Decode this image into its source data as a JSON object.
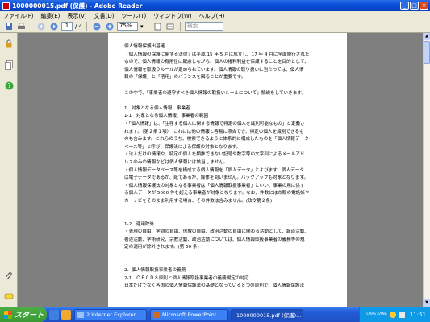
{
  "window": {
    "title": "1000000015.pdf (保護) - Adobe Reader"
  },
  "menu": {
    "items": [
      "ファイル(F)",
      "編集(E)",
      "表示(V)",
      "文書(D)",
      "ツール(T)",
      "ウィンドウ(W)",
      "ヘルプ(H)"
    ]
  },
  "toolbar": {
    "page_current": "1",
    "page_total": "/ 4",
    "zoom": "75%",
    "search_placeholder": "検索"
  },
  "document": {
    "lines": [
      "個人情報保護出基確",
      "",
      "「個人情報の保護に関する法律」は平成 15 年 5 月に成立し、17 年 4 月に全面施行された",
      "もので、個人情報の有用性に配慮しながら、個人の権利利益を保護することを目的として、",
      "個人情報を取扱うルールが定められています。個人情報の取り扱いに当たっては、個人情",
      "報の「保護」と「活用」のバランスを図ることが重要です。",
      "",
      "この中で、「事業者の遵守すべき個人情報の取扱いルールについて」解説をしていきます。",
      "",
      "1．対象となる個人情報、事業者",
      "1-1　対象となる個人情報、事業者の範囲",
      "・「個人情報」は、「生存する個人に関する情報で特定の個人を識別可能なもの」と定義さ",
      "れます。（第２条１項）　これには他の情報と容易に照合でき、特定の個人を識別できるも",
      "のも含みます。これらのうち、検索できるように体系的に構成したものを「個人情報データ",
      "ベース等」と呼び、保護法による保護の対象となります。",
      "・法人だけの情報や、特定の個人を類推できない記号や数字等の文字列によるメールアド",
      "レスのみの情報などは個人情報には該当しません。",
      "・個人情報データベース等を構成する個人情報を「個人データ」とよびます。個人データ",
      "は電子データであるか、紙であるか、媒体を問いません。バックアップも対象となります。",
      "・個人情報保護法の対象となる事業者は「個人情報取扱事業者」といい、事業の用に供す",
      "る個人データが 5000 件を超える事業者が対象となります。なお、件数には市販の電話帳や",
      "カーナビをそのまま利用する場合、その件数は含みません。(政令第２条)",
      "",
      "",
      "1-2　適用除外",
      "・表現の自由、学問の自由、信教の自由、政治活動の自由に関わる活動として、報道活動、",
      "著述活動、学術研究、宗教活動、政治活動については、個人情報取扱事業者の義務等の規",
      "定の適用が除外されます。(第 50 条)",
      "",
      "",
      "2．個人情報取扱事業者の義務",
      "2-1　ＯＥＣＤ８原則と個人情報取扱事業者の義務規定の対応",
      "日本だけでなく各国の個人情報保護法の基礎となっている８つの原則で、個人情報保護法"
    ]
  },
  "taskbar": {
    "start_label": "スタート",
    "tasks": [
      {
        "label": "2 Internet Explorer",
        "color": "#3f7fe0"
      },
      {
        "label": "Microsoft PowerPoint...",
        "color": "#d2691e"
      },
      {
        "label": "1000000015.pdf (保護)...",
        "color": "#c00000"
      }
    ],
    "clock": "11:51",
    "caps": "CAPS KANA"
  },
  "colors": {
    "titlebar": "#0a4fd8",
    "taskbar": "#245edb",
    "start": "#3b9a35"
  },
  "icons": {
    "nav": [
      "lock-icon",
      "pages-icon",
      "help-icon",
      "attachment-icon",
      "comment-icon"
    ],
    "toolbar": [
      "save-icon",
      "print-icon",
      "prev-icon",
      "next-icon",
      "zoom-out-icon",
      "zoom-in-icon",
      "fit-page-icon",
      "fit-width-icon"
    ]
  }
}
